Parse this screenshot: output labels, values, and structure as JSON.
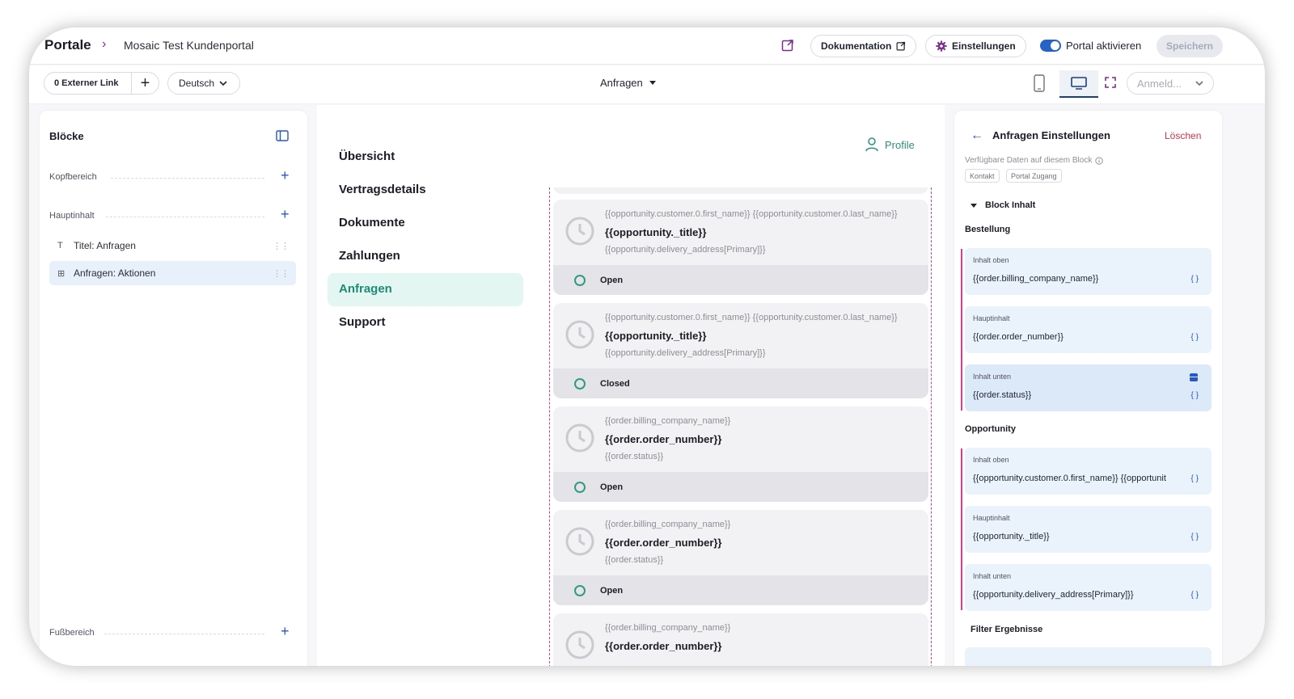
{
  "topbar": {
    "breadcrumb_root": "Portale",
    "breadcrumb_separator": "›",
    "breadcrumb_page": "Mosaic Test Kundenportal",
    "docs_label": "Dokumentation",
    "settings_label": "Einstellungen",
    "portal_toggle_label": "Portal aktivieren",
    "portal_toggle_on": true,
    "save_label": "Speichern"
  },
  "subbar": {
    "external_link_label": "0 Externer Link",
    "add_symbol": "+",
    "language": "Deutsch",
    "current_page": "Anfragen",
    "login_placeholder": "Anmeld..."
  },
  "left_panel": {
    "title": "Blöcke",
    "sections": {
      "header": "Kopfbereich",
      "main": "Hauptinhalt",
      "footer": "Fußbereich"
    },
    "items": [
      {
        "icon": "T",
        "label": "Titel: Anfragen"
      },
      {
        "icon": "⊞",
        "label": "Anfragen: Aktionen"
      }
    ],
    "add_symbol": "+"
  },
  "preview": {
    "nav": [
      "Übersicht",
      "Vertragsdetails",
      "Dokumente",
      "Zahlungen",
      "Anfragen",
      "Support"
    ],
    "active_nav": "Anfragen",
    "profile_label": "Profile",
    "cards": [
      {
        "line1": "{{opportunity.customer.0.first_name}} {{opportunity.customer.0.last_name}}",
        "line2": "{{opportunity._title}}",
        "line3": "{{opportunity.delivery_address[Primary]}}",
        "status": "Open"
      },
      {
        "line1": "{{opportunity.customer.0.first_name}} {{opportunity.customer.0.last_name}}",
        "line2": "{{opportunity._title}}",
        "line3": "{{opportunity.delivery_address[Primary]}}",
        "status": "Closed"
      },
      {
        "line1": "{{order.billing_company_name}}",
        "line2": "{{order.order_number}}",
        "line3": "{{order.status}}",
        "status": "Open"
      },
      {
        "line1": "{{order.billing_company_name}}",
        "line2": "{{order.order_number}}",
        "line3": "{{order.status}}",
        "status": "Open"
      },
      {
        "line1": "{{order.billing_company_name}}",
        "line2": "{{order.order_number}}",
        "line3": "",
        "status": ""
      }
    ]
  },
  "right_panel": {
    "title": "Anfragen Einstellungen",
    "delete_label": "Löschen",
    "available_data_label": "Verfügbare Daten auf diesem Block",
    "tags": [
      "Kontakt",
      "Portal Zugang"
    ],
    "block_content_label": "Block Inhalt",
    "group_order": "Bestellung",
    "group_opportunity": "Opportunity",
    "filter_label": "Filter Ergebnisse",
    "brace_symbol": "{ }",
    "order_fields": [
      {
        "label": "Inhalt oben",
        "value": "{{order.billing_company_name}}"
      },
      {
        "label": "Hauptinhalt",
        "value": "{{order.order_number}}"
      },
      {
        "label": "Inhalt unten",
        "value": "{{order.status}}"
      }
    ],
    "opportunity_fields": [
      {
        "label": "Inhalt oben",
        "value": "{{opportunity.customer.0.first_name}} {{opportunit"
      },
      {
        "label": "Hauptinhalt",
        "value": "{{opportunity._title}}"
      },
      {
        "label": "Inhalt unten",
        "value": "{{opportunity.delivery_address[Primary]}}"
      }
    ]
  },
  "colors": {
    "accent_blue": "#2a56c6",
    "accent_teal": "#1f8a75",
    "accent_magenta": "#d43f8d",
    "danger": "#d2344a"
  }
}
